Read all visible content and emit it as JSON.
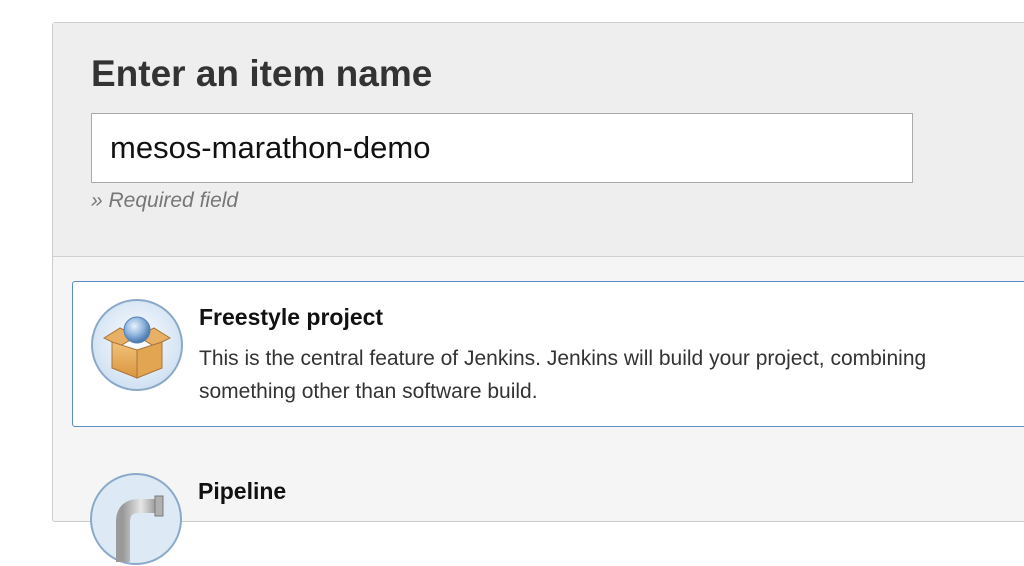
{
  "form": {
    "heading": "Enter an item name",
    "item_name_value": "mesos-marathon-demo",
    "required_hint": "» Required field"
  },
  "item_types": [
    {
      "label": "Freestyle project",
      "description_line1": "This is the central feature of Jenkins. Jenkins will build your project, combining",
      "description_line2": "something other than software build.",
      "icon": "freestyle-box-icon",
      "selected": true
    },
    {
      "label": "Pipeline",
      "icon": "pipeline-pipe-icon",
      "selected": false
    }
  ],
  "colors": {
    "selected_border": "#5b8ec7",
    "panel_background": "#eeeeee"
  }
}
